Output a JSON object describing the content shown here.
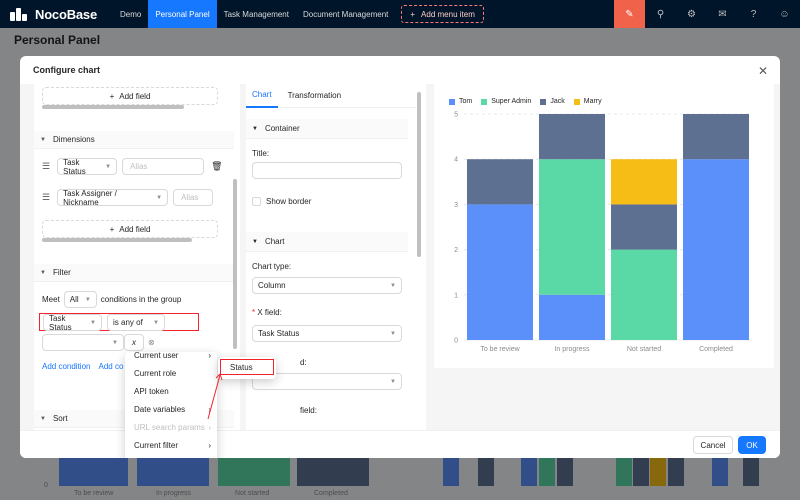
{
  "topbar": {
    "logo": "NocoBase",
    "menu": [
      "Demo",
      "Personal Panel",
      "Task Management",
      "Document Management"
    ],
    "add_menu": "Add menu item",
    "icons": [
      "highlight-icon",
      "plugin-icon",
      "settings-icon",
      "mail-icon",
      "help-icon",
      "user-icon"
    ]
  },
  "page": {
    "title": "Personal Panel"
  },
  "modal": {
    "title": "Configure chart",
    "cancel": "Cancel",
    "ok": "OK",
    "left": {
      "add_field": "Add field",
      "dimensions_title": "Dimensions",
      "dimensions": [
        {
          "field": "Task Status",
          "alias_placeholder": "Alias"
        },
        {
          "field": "Task Assigner  /  Nickname",
          "alias_placeholder": "Alias"
        }
      ],
      "filter_title": "Filter",
      "meet": "Meet",
      "meet_value": "All",
      "meet_suffix": "conditions in the group",
      "filter_field": "Task Status",
      "filter_op": "is any of",
      "var_symbol": "x",
      "add_condition": "Add condition",
      "add_group_partial": "Add co",
      "sort_title": "Sort"
    },
    "variables_menu": {
      "items": [
        {
          "label": "Current user",
          "arrow": true,
          "disabled": false
        },
        {
          "label": "Current role",
          "arrow": false,
          "disabled": false
        },
        {
          "label": "API token",
          "arrow": false,
          "disabled": false
        },
        {
          "label": "Date variables",
          "arrow": true,
          "disabled": false
        },
        {
          "label": "URL search params",
          "arrow": true,
          "disabled": true
        },
        {
          "label": "Current filter",
          "arrow": true,
          "disabled": false
        }
      ],
      "submenu": [
        "Status"
      ]
    },
    "mid": {
      "tabs": [
        "Chart",
        "Transformation"
      ],
      "container_title": "Container",
      "title_label": "Title",
      "show_border": "Show border",
      "chart_title": "Chart",
      "chart_type_label": "Chart type",
      "chart_type": "Column",
      "x_field_label": "X field",
      "x_field": "Task Status",
      "partial_label_1": "d",
      "partial_label_2": "field"
    }
  },
  "chart_data": {
    "type": "bar",
    "stacked": true,
    "categories": [
      "To be review",
      "In progress",
      "Not started",
      "Completed"
    ],
    "series": [
      {
        "name": "Tom",
        "color": "#5b8ff9",
        "values": [
          3,
          1,
          0,
          4
        ]
      },
      {
        "name": "Super Admin",
        "color": "#5ad8a6",
        "values": [
          0,
          3,
          2,
          0
        ]
      },
      {
        "name": "Jack",
        "color": "#5d7092",
        "values": [
          1,
          1,
          1,
          1
        ]
      },
      {
        "name": "Marry",
        "color": "#f6bd16",
        "values": [
          0,
          0,
          1,
          0
        ]
      }
    ],
    "yticks": [
      0,
      1,
      2,
      3,
      4,
      5
    ],
    "ylim": [
      0,
      5
    ],
    "legend": "top-left"
  },
  "background_chart": {
    "categories": [
      "To be review",
      "In progress",
      "Not started",
      "Completed"
    ],
    "zero_label": "0"
  }
}
